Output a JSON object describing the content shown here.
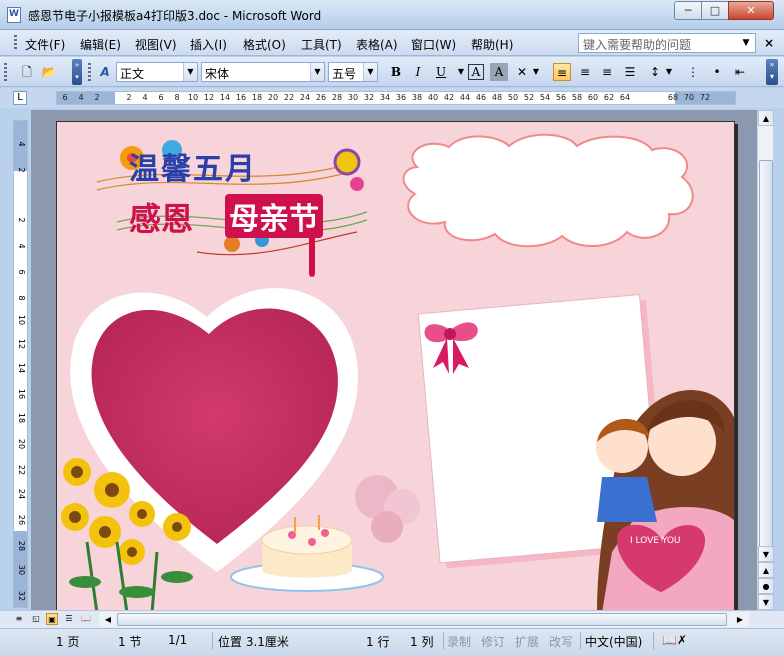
{
  "window": {
    "title": "感恩节电子小报模板a4打印版3.doc - Microsoft Word",
    "minimize_label": "─",
    "maximize_label": "□",
    "close_label": "✕"
  },
  "menu": {
    "items": [
      "文件(F)",
      "编辑(E)",
      "视图(V)",
      "插入(I)",
      "格式(O)",
      "工具(T)",
      "表格(A)",
      "窗口(W)",
      "帮助(H)"
    ],
    "help_placeholder": "键入需要帮助的问题",
    "close_doc": "×"
  },
  "toolbar": {
    "style_value": "正文",
    "font_value": "宋体",
    "size_value": "五号",
    "bold": "B",
    "italic": "I",
    "underline": "U",
    "char_border": "A",
    "char_shading": "A"
  },
  "ruler": {
    "corner": "L",
    "h_ticks": [
      "6",
      "4",
      "2",
      "2",
      "4",
      "6",
      "8",
      "10",
      "12",
      "14",
      "16",
      "18",
      "20",
      "22",
      "24",
      "26",
      "28",
      "30",
      "32",
      "34",
      "36",
      "38",
      "40",
      "42",
      "44",
      "46",
      "48",
      "50",
      "52",
      "54",
      "56",
      "58",
      "60",
      "62",
      "64",
      "68",
      "70",
      "72"
    ],
    "v_ticks": [
      "4",
      "2",
      "2",
      "4",
      "6",
      "8",
      "10",
      "12",
      "14",
      "16",
      "18",
      "20",
      "22",
      "24",
      "26",
      "28",
      "30",
      "32"
    ]
  },
  "poster": {
    "title_line1": "温馨五月",
    "title_line2": "感恩",
    "title_line3": "母亲节",
    "love_text": "I LOVE YOU"
  },
  "status": {
    "page": "1 页",
    "section": "1 节",
    "page_of": "1/1",
    "position": "位置 3.1厘米",
    "line": "1 行",
    "column": "1 列",
    "rec": "录制",
    "trk": "修订",
    "ext": "扩展",
    "ovr": "改写",
    "language": "中文(中国)"
  },
  "colors": {
    "page_bg": "#f7d4d9",
    "heart": "#c93366",
    "title_blue": "#2a3fa8",
    "title_red": "#d0104c"
  }
}
